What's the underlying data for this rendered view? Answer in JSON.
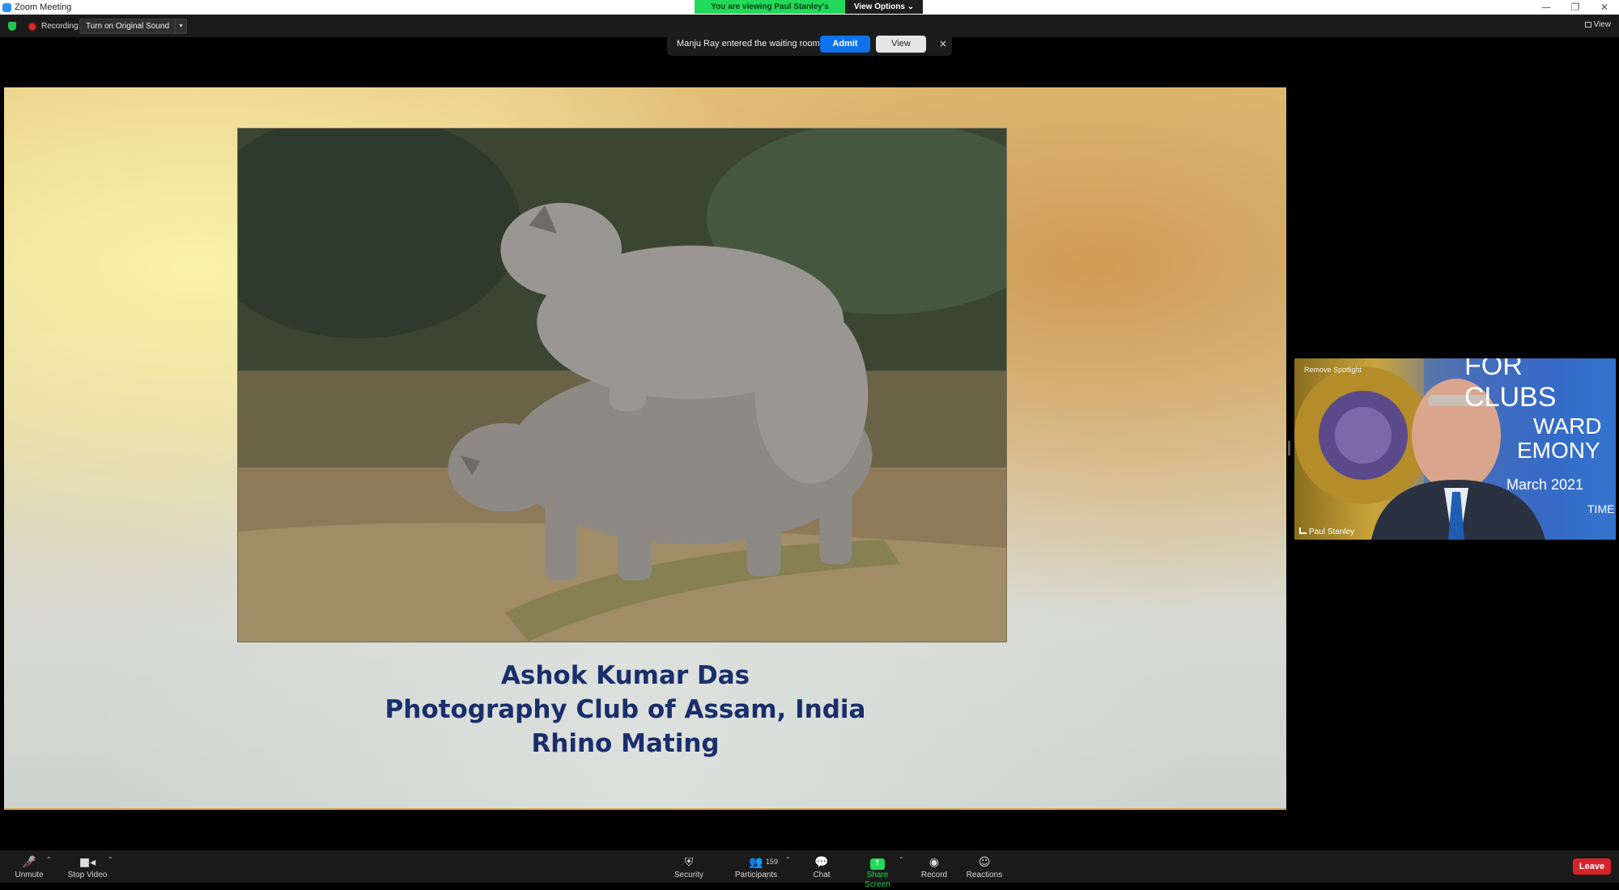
{
  "window": {
    "title": "Zoom Meeting",
    "controls": [
      "—",
      "❐",
      "✕"
    ]
  },
  "banner": {
    "viewing": "You are viewing Paul Stanley's screen",
    "view_options": "View Options ⌄"
  },
  "topbar": {
    "recording": "Recording",
    "original_sound": "Turn on Original Sound",
    "view": "View"
  },
  "waiting_room": {
    "message": "Manju Ray entered the waiting room",
    "admit": "Admit",
    "view": "View",
    "close": "×"
  },
  "slide": {
    "caption_lines": [
      "Ashok Kumar Das",
      "Photography Club of Assam, India",
      "Rhino Mating"
    ],
    "border_color": "#d9a14b",
    "caption_color": "#1a2e6b"
  },
  "speaker": {
    "name": "Paul Stanley",
    "spotlight": "Remove Spotlight",
    "background_text": [
      "FOR CLUBS",
      "WARD",
      "EMONY",
      "March 2021",
      "TIME"
    ]
  },
  "toolbar": {
    "unmute": "Unmute",
    "stop_video": "Stop Video",
    "security": "Security",
    "participants": "Participants",
    "participants_count": "159",
    "chat": "Chat",
    "share_screen": "Share Screen",
    "record": "Record",
    "reactions": "Reactions",
    "leave": "Leave",
    "accent_share": "#23d959",
    "accent_leave": "#d8232a"
  }
}
